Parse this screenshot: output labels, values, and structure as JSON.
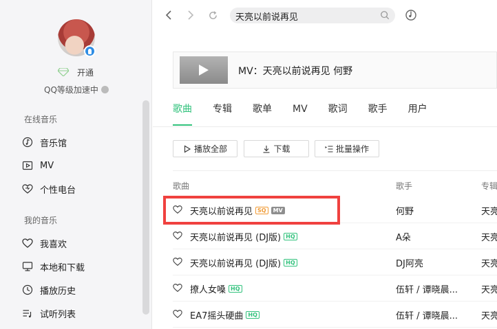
{
  "sidebar": {
    "vip_label": "开通",
    "level_label": "QQ等级加速中",
    "section_online": "在线音乐",
    "online_items": [
      {
        "label": "音乐馆",
        "icon": "music-hall-icon"
      },
      {
        "label": "MV",
        "icon": "mv-icon"
      },
      {
        "label": "个性电台",
        "icon": "radio-heart-icon"
      }
    ],
    "section_mine": "我的音乐",
    "mine_items": [
      {
        "label": "我喜欢",
        "icon": "heart-icon"
      },
      {
        "label": "本地和下载",
        "icon": "monitor-icon"
      },
      {
        "label": "播放历史",
        "icon": "history-icon"
      },
      {
        "label": "试听列表",
        "icon": "playlist-icon"
      }
    ]
  },
  "topbar": {
    "search_value": "天亮以前说再见"
  },
  "mv_banner": {
    "title": "MV：天亮以前说再见   何野"
  },
  "tabs": [
    {
      "label": "歌曲",
      "active": true
    },
    {
      "label": "专辑",
      "active": false
    },
    {
      "label": "歌单",
      "active": false
    },
    {
      "label": "MV",
      "active": false
    },
    {
      "label": "歌词",
      "active": false
    },
    {
      "label": "歌手",
      "active": false
    },
    {
      "label": "用户",
      "active": false
    }
  ],
  "actions": {
    "play_all": "播放全部",
    "download": "下载",
    "batch": "批量操作"
  },
  "table": {
    "headers": {
      "song": "歌曲",
      "singer": "歌手",
      "album": "专辑"
    },
    "rows": [
      {
        "name": "天亮以前说再见",
        "badges": [
          "SQ",
          "MV"
        ],
        "singer": "何野",
        "album": "天亮"
      },
      {
        "name": "天亮以前说再见 (DJ版)",
        "badges": [
          "HQ"
        ],
        "singer": "A朵",
        "album": "天亮"
      },
      {
        "name": "天亮以前说再见 (DJ版)",
        "badges": [
          "HQ"
        ],
        "singer": "DJ阿亮",
        "album": "天亮"
      },
      {
        "name": "撩人女嗓",
        "badges": [
          "HQ"
        ],
        "singer": "伍轩 / 谭晓晨...",
        "album": "天亮"
      },
      {
        "name": "EA7摇头硬曲",
        "badges": [
          "HQ"
        ],
        "singer": "伍轩 / 谭晓晨...",
        "album": "天亮"
      }
    ]
  },
  "colors": {
    "accent": "#31c27c",
    "highlight": "#f0413f"
  }
}
